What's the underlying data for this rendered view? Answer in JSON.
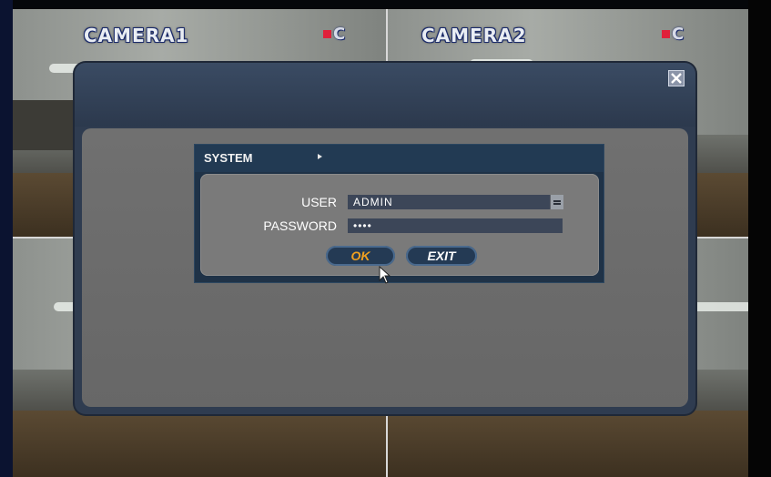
{
  "cameras": [
    {
      "label": "CAMERA1",
      "indicator": "C"
    },
    {
      "label": "CAMERA2",
      "indicator": "C"
    }
  ],
  "dialog": {
    "title": "SYSTEM",
    "fields": {
      "user_label": "USER",
      "user_value": "ADMIN",
      "password_label": "PASSWORD",
      "password_value": "••••"
    },
    "buttons": {
      "ok_label": "OK",
      "exit_label": "EXIT"
    }
  },
  "colors": {
    "rec_indicator": "#e0203a",
    "ok_text": "#f0a020",
    "panel_bg": "#1f3247",
    "modal_frame": "#2f3c50"
  },
  "icons": [
    "close-icon",
    "arrow-right-icon",
    "spinner-icon",
    "mouse-cursor-icon"
  ]
}
